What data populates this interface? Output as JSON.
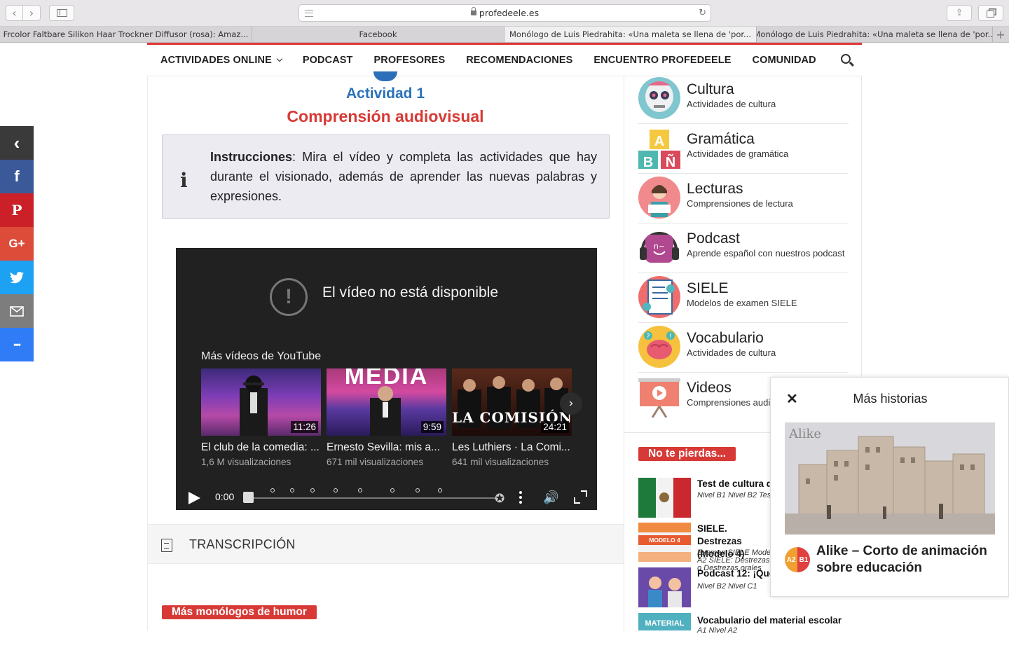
{
  "browser": {
    "url": "profedeele.es",
    "tabs": [
      {
        "label": "Frcolor Faltbare Silikon Haar Trockner Diffusor (rosa): Amaz..."
      },
      {
        "label": "Facebook"
      },
      {
        "label": "Monólogo de Luis Piedrahita: «Una maleta se llena de 'por..."
      },
      {
        "label": "Monólogo de Luis Piedrahita: «Una maleta se llena de 'por..."
      }
    ],
    "new_tab": "+"
  },
  "nav": {
    "items": [
      "ACTIVIDADES ONLINE",
      "PODCAST",
      "PROFESORES",
      "RECOMENDACIONES",
      "ENCUENTRO PROFEDEELE",
      "COMUNIDAD"
    ]
  },
  "social": [
    {
      "icon": "collapse-icon",
      "glyph": "‹",
      "color": "#3a3a3a"
    },
    {
      "icon": "facebook-icon",
      "glyph": "f",
      "color": "#3b5998"
    },
    {
      "icon": "pinterest-icon",
      "glyph": "P",
      "color": "#cb2027"
    },
    {
      "icon": "googleplus-icon",
      "glyph": "G+",
      "color": "#dd4b39"
    },
    {
      "icon": "twitter-icon",
      "glyph": "🐦",
      "color": "#1da1f2"
    },
    {
      "icon": "email-icon",
      "glyph": "✉",
      "color": "#7d7d7d"
    },
    {
      "icon": "more-icon",
      "glyph": "•••",
      "color": "#2f7cf6"
    }
  ],
  "activity": {
    "number": "Actividad 1",
    "title": "Comprensión audiovisual",
    "instr_bold": "Instrucciones",
    "instr_text": ": Mira el vídeo y completa las actividades que hay durante el visionado, además de aprender las nuevas palabras y expresiones."
  },
  "video": {
    "error": "El vídeo no está disponible",
    "more": "Más vídeos de YouTube",
    "items": [
      {
        "title": "El club de la comedia: ...",
        "views": "1,6 M visualizaciones",
        "duration": "11:26"
      },
      {
        "title": "Ernesto Sevilla: mis a...",
        "views": "671 mil visualizaciones",
        "duration": "9:59"
      },
      {
        "title": "Les Luthiers · La Comi...",
        "views": "641 mil visualizaciones",
        "duration": "24:21"
      }
    ],
    "thumb_text_2": "MEDIA",
    "thumb_text_3": "LA COMISIÓN",
    "time": "0:00"
  },
  "transcription": "TRANSCRIPCIÓN",
  "more_monologues": "Más monólogos de humor",
  "categories": [
    {
      "title": "Cultura",
      "sub": "Actividades de cultura",
      "color": "#7fc6cf"
    },
    {
      "title": "Gramática",
      "sub": "Actividades de gramática",
      "color": "#f5c842"
    },
    {
      "title": "Lecturas",
      "sub": "Comprensiones de lectura",
      "color": "#f08a8c"
    },
    {
      "title": "Podcast",
      "sub": "Aprende español con nuestros podcast",
      "color": "#b0498f"
    },
    {
      "title": "SIELE",
      "sub": "Modelos de examen SIELE",
      "color": "#ef6d6d"
    },
    {
      "title": "Vocabulario",
      "sub": "Actividades de cultura",
      "color": "#f6c23e"
    },
    {
      "title": "Videos",
      "sub": "Comprensiones audio",
      "color": "#f08070"
    }
  ],
  "no_te_pierdas": "No te pierdas...",
  "posts": [
    {
      "title": "Test de cultura d",
      "tags": "Nivel B1  Nivel B2  Tes"
    },
    {
      "title": "SIELE. Destrezas (Modelo 4)",
      "tags": "Examen SIELE  Model A2  SIELE: Destrezas o Destrezas orales",
      "thumb_label": "MODELO 4"
    },
    {
      "title": "Podcast 12: ¡Qué",
      "tags": "Nivel B2  Nivel C1"
    },
    {
      "title": "Vocabulario del material escolar",
      "tags": "A1  Nivel A2",
      "thumb_label": "MATERIAL"
    }
  ],
  "popup": {
    "title": "Más historias",
    "close": "✕",
    "story": "Alike – Corto de animación sobre educación",
    "image_text": "Alike",
    "badge_a": "A2",
    "badge_b": "B1"
  }
}
